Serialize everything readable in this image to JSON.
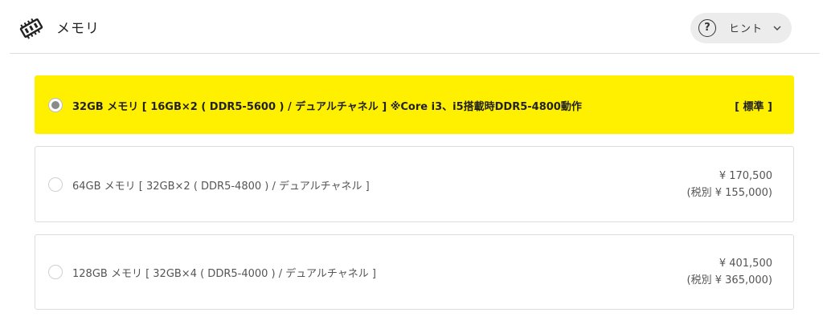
{
  "header": {
    "title": "メモリ",
    "icon": "memory-chip-icon",
    "hint_label": "ヒント",
    "hint_icon": "question-circle-icon",
    "hint_chevron": "chevron-down-icon"
  },
  "colors": {
    "selected_bg": "#fff000",
    "border": "#dcdcdc"
  },
  "options": [
    {
      "label": "32GB メモリ [ 16GB×2 ( DDR5-5600 ) / デュアルチャネル ] ※Core i3、i5搭載時DDR5-4800動作",
      "badge": "[ 標準 ]",
      "selected": true
    },
    {
      "label": "64GB メモリ [ 32GB×2 ( DDR5-4800 ) / デュアルチャネル ]",
      "price": "¥ 170,500",
      "price_excl": "(税別 ¥ 155,000)",
      "selected": false
    },
    {
      "label": "128GB メモリ [ 32GB×4 ( DDR5-4000 ) / デュアルチャネル ]",
      "price": "¥ 401,500",
      "price_excl": "(税別 ¥ 365,000)",
      "selected": false
    }
  ]
}
